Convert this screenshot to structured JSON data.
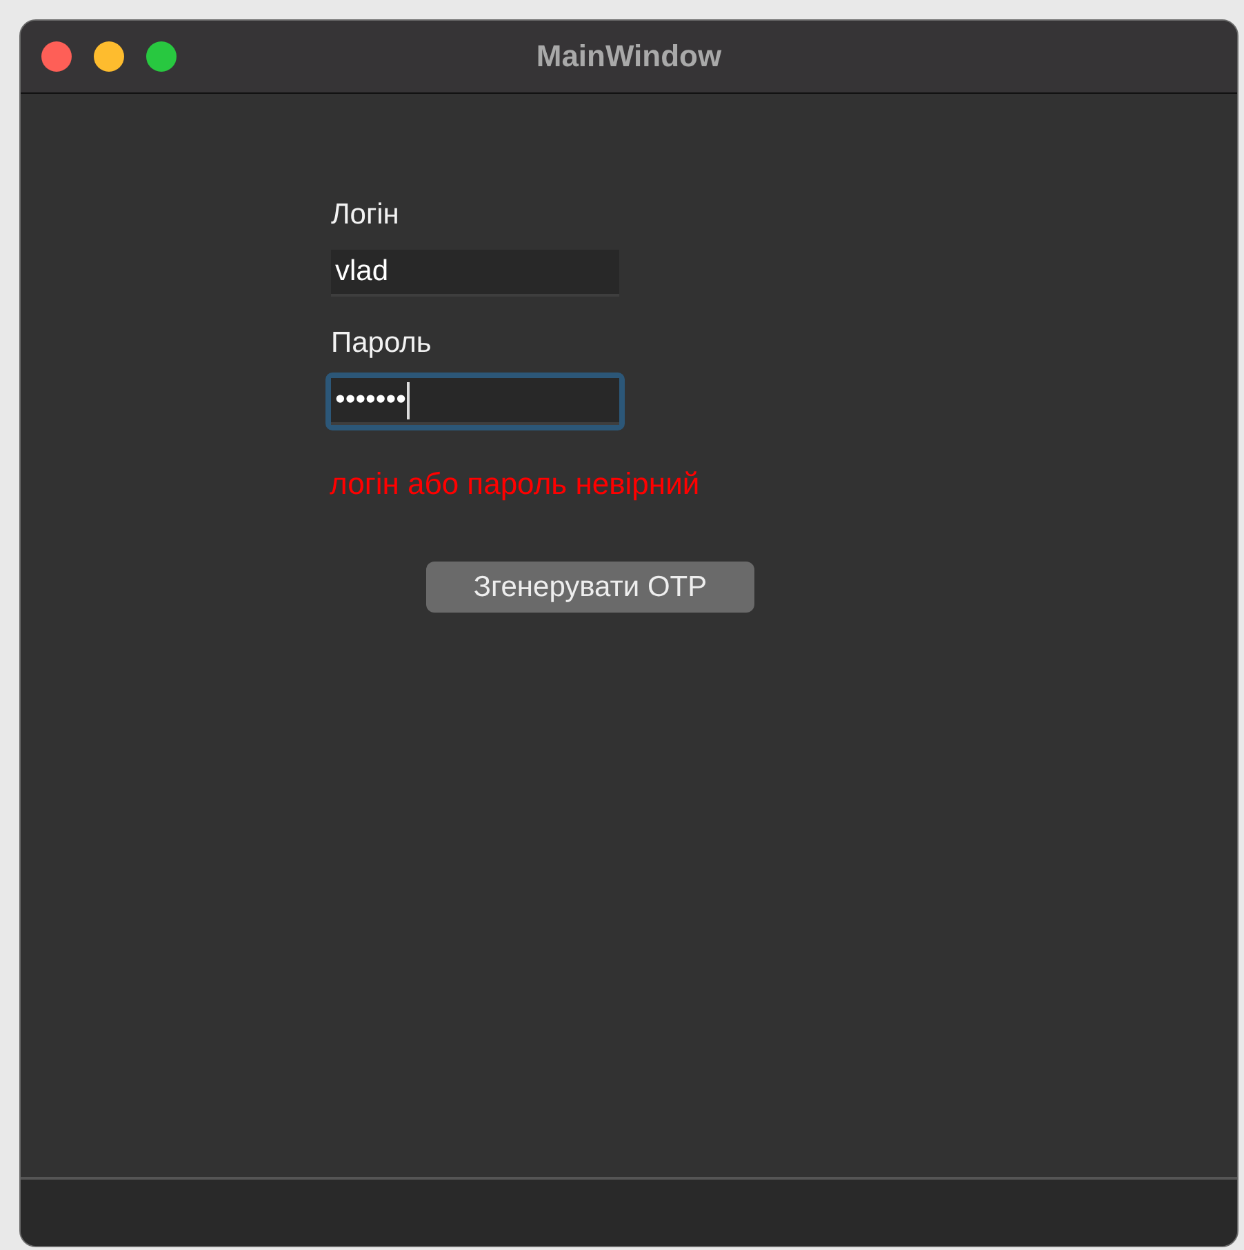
{
  "window": {
    "title": "MainWindow"
  },
  "form": {
    "fields": [
      {
        "label": "Логін",
        "value": "vlad",
        "focused": false
      },
      {
        "label": "Пароль",
        "value": "•••••••",
        "focused": true
      }
    ],
    "error": "логін або пароль невірний",
    "button": "Згенерувати OTP"
  }
}
